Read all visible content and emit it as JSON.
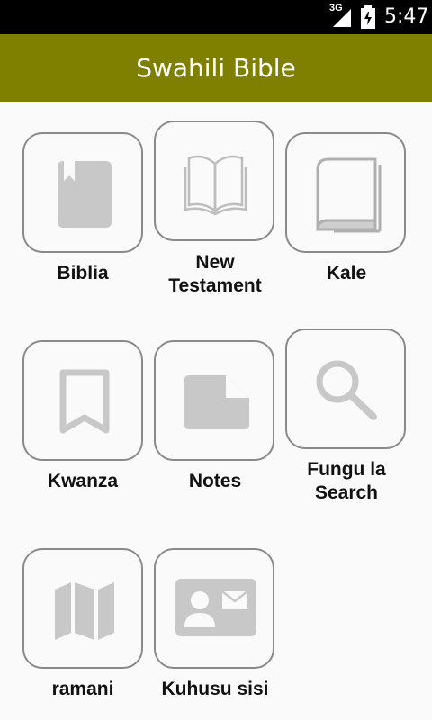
{
  "status_bar": {
    "network": "3G",
    "time": "5:47",
    "icons": [
      "signal-icon",
      "battery-icon"
    ]
  },
  "app_bar": {
    "title": "Swahili Bible",
    "color": "#808000"
  },
  "menu": {
    "items": [
      {
        "label": "Biblia",
        "icon": "bookmark-book-icon"
      },
      {
        "label": "New\nTestament",
        "icon": "open-book-icon"
      },
      {
        "label": "Kale",
        "icon": "closed-book-icon"
      },
      {
        "label": "Kwanza",
        "icon": "bookmark-icon"
      },
      {
        "label": "Notes",
        "icon": "note-icon"
      },
      {
        "label": "Fungu la\nSearch",
        "icon": "search-icon"
      },
      {
        "label": "ramani",
        "icon": "map-icon"
      },
      {
        "label": "Kuhusu sisi",
        "icon": "contact-card-icon"
      }
    ]
  }
}
